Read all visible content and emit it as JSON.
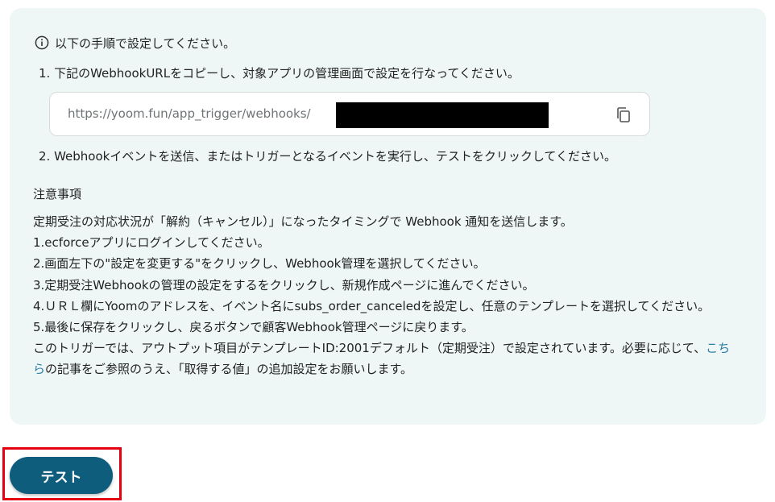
{
  "instructions": {
    "header": "以下の手順で設定してください。",
    "step1": "1. 下記のWebhookURLをコピーし、対象アプリの管理画面で設定を行なってください。",
    "url": "https://yoom.fun/app_trigger/webhooks/",
    "step2": "2. Webhookイベントを送信、またはトリガーとなるイベントを実行し、テストをクリックしてください。"
  },
  "notes": {
    "title": "注意事項",
    "lines": [
      "定期受注の対応状況が「解約（キャンセル）」になったタイミングで Webhook 通知を送信します。",
      "1.ecforceアプリにログインしてください。",
      "2.画面左下の\"設定を変更する\"をクリックし、Webhook管理を選択してください。",
      "3.定期受注Webhookの管理の設定をするをクリックし、新規作成ページに進んでください。",
      "4.ＵＲＬ欄にYoomのアドレスを、イベント名にsubs_order_canceledを設定し、任意のテンプレートを選択してください。",
      "5.最後に保存をクリックし、戻るボタンで顧客Webhook管理ページに戻ります。"
    ],
    "last_before": "このトリガーでは、アウトプット項目がテンプレートID:2001デフォルト（定期受注）で設定されています。必要に応じて、",
    "link_text": "こちら",
    "last_after": "の記事をご参照のうえ、「取得する値」の追加設定をお願いします。"
  },
  "actions": {
    "test_label": "テスト"
  },
  "icons": {
    "header": "info-icon",
    "copy": "copy-icon"
  },
  "colors": {
    "panel_bg": "#eef7f6",
    "button_bg": "#0f5d7c",
    "link": "#2a7fa3",
    "highlight": "#e60012"
  }
}
